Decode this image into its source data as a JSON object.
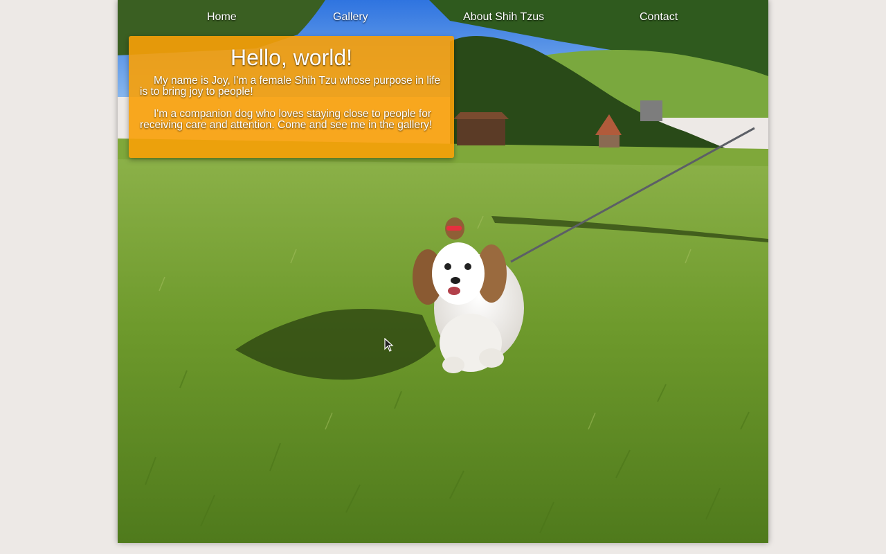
{
  "nav": {
    "items": [
      {
        "label": "Home"
      },
      {
        "label": "Gallery"
      },
      {
        "label": "About Shih Tzus"
      },
      {
        "label": "Contact"
      }
    ]
  },
  "intro": {
    "heading": "Hello, world!",
    "paragraphs": [
      "My name is Joy, I'm a female Shih Tzu whose purpose in life is to bring joy to people!",
      "I'm a companion dog who loves staying close to people for receiving care and attention. Come and see me in the gallery!"
    ]
  },
  "colors": {
    "card_background": "#f8a008",
    "sky": "#3f86e8",
    "grass": "#6e9a2c",
    "page_background": "#ede9e6"
  },
  "hero": {
    "image": "shih-tzu-dog-on-leash-in-grass-field"
  }
}
